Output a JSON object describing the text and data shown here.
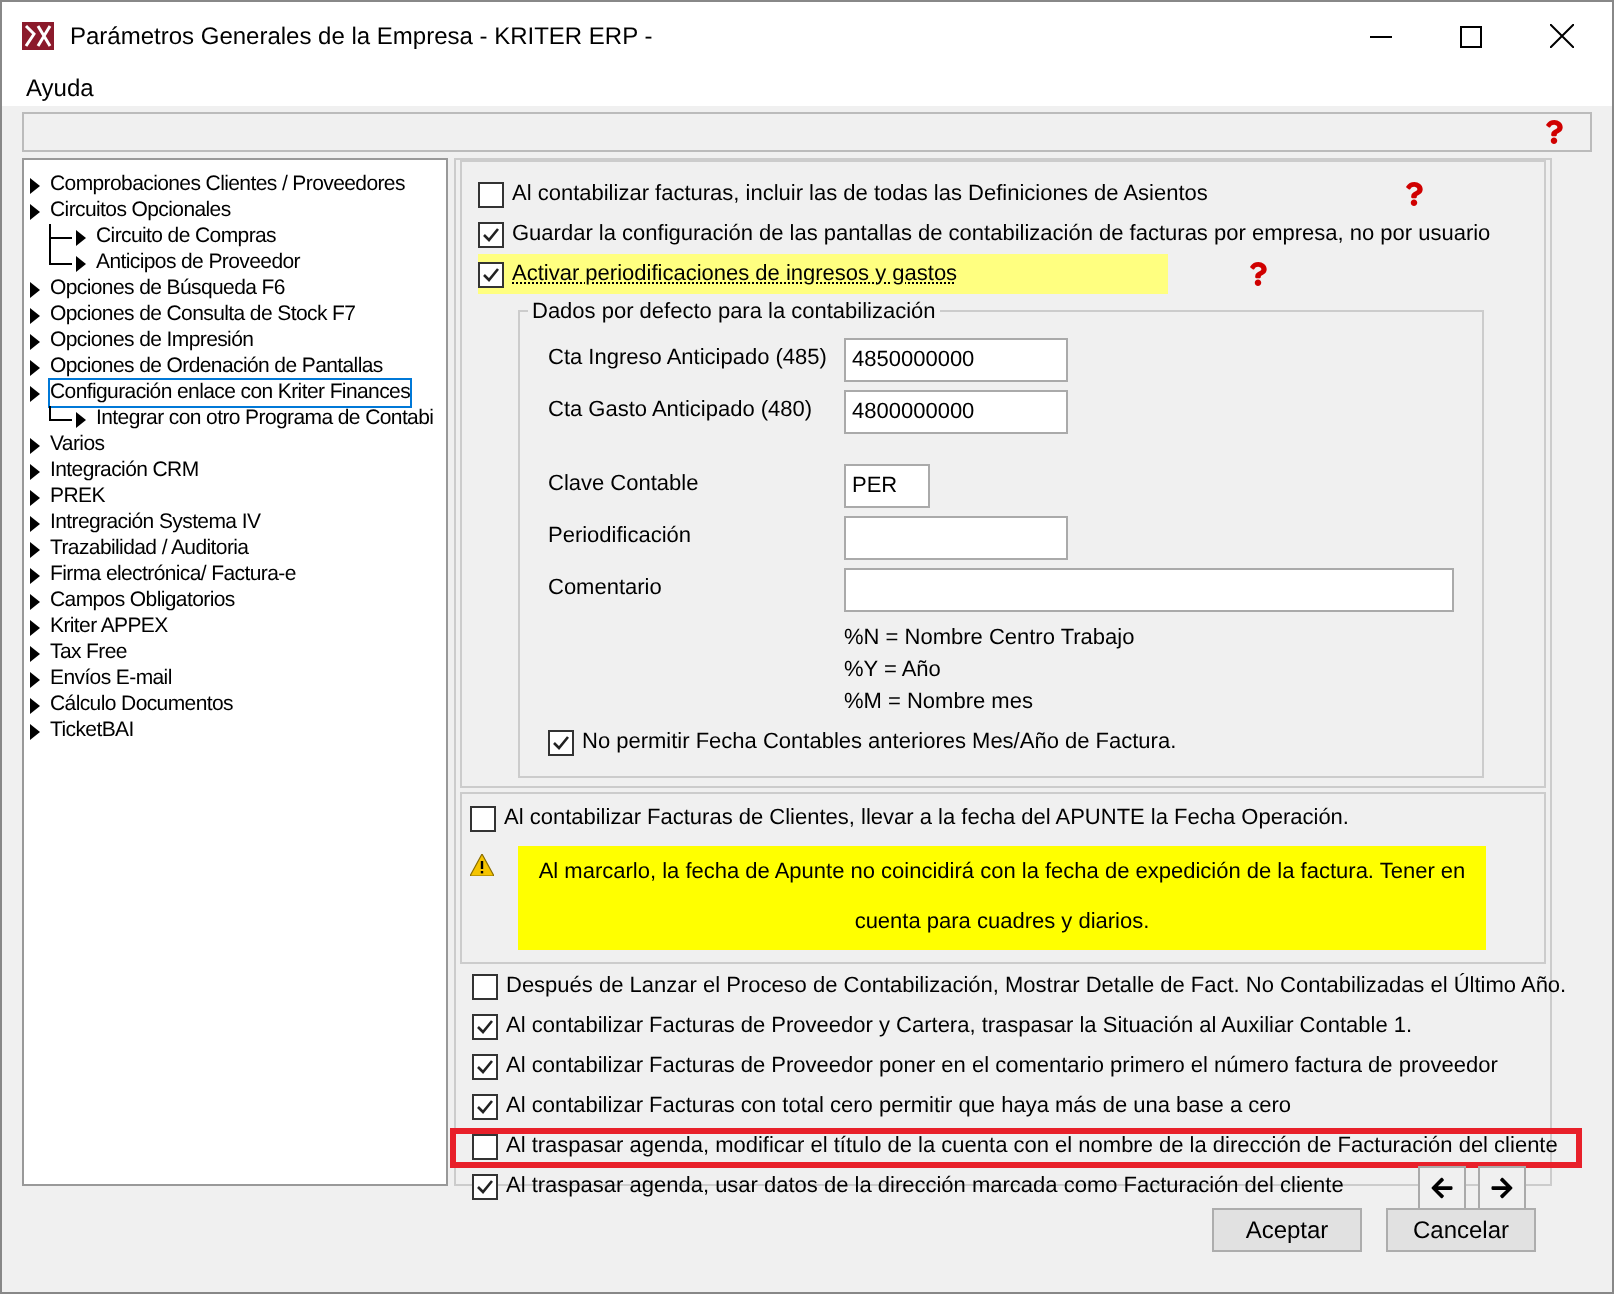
{
  "window": {
    "title": "Parámetros Generales de la Empresa - KRITER ERP -"
  },
  "menu": [
    "Ayuda"
  ],
  "tree": [
    {
      "label": "Comprobaciones Clientes / Proveedores",
      "selected": false
    },
    {
      "label": "Circuitos Opcionales",
      "selected": false,
      "children": [
        {
          "label": "Circuito de Compras",
          "selected": false
        },
        {
          "label": "Anticipos de Proveedor",
          "selected": false
        }
      ]
    },
    {
      "label": "Opciones de Búsqueda F6",
      "selected": false
    },
    {
      "label": "Opciones de Consulta de Stock F7",
      "selected": false
    },
    {
      "label": "Opciones de Impresión",
      "selected": false
    },
    {
      "label": "Opciones de Ordenación de Pantallas",
      "selected": false
    },
    {
      "label": "Configuración enlace con Kriter Finances",
      "selected": true,
      "children": [
        {
          "label": "Integrar con otro Programa de Contabi",
          "selected": false
        }
      ]
    },
    {
      "label": "Varios",
      "selected": false
    },
    {
      "label": "Integración CRM",
      "selected": false
    },
    {
      "label": "PREK",
      "selected": false
    },
    {
      "label": "Intregración Systema IV",
      "selected": false
    },
    {
      "label": "Trazabilidad / Auditoria",
      "selected": false
    },
    {
      "label": "Firma electrónica/ Factura-e",
      "selected": false
    },
    {
      "label": "Campos Obligatorios",
      "selected": false
    },
    {
      "label": "Kriter APPEX",
      "selected": false
    },
    {
      "label": "Tax Free",
      "selected": false
    },
    {
      "label": "Envíos E-mail",
      "selected": false
    },
    {
      "label": "Cálculo Documentos",
      "selected": false
    },
    {
      "label": "TicketBAI",
      "selected": false
    }
  ],
  "options_top": [
    {
      "label": "Al contabilizar facturas, incluir las de todas las Definiciones de Asientos",
      "checked": false,
      "highlighted": false,
      "help": true
    },
    {
      "label": "Guardar la configuración de las pantallas de contabilización de facturas por empresa, no por usuario",
      "checked": true,
      "highlighted": false,
      "help": false
    },
    {
      "label": "Activar periodificaciones de ingresos y gastos",
      "checked": true,
      "highlighted": true,
      "help": true
    }
  ],
  "defaults_group": {
    "title": "Dados por defecto para la contabilización",
    "fields": [
      {
        "label": "Cta Ingreso Anticipado (485)",
        "value": "4850000000"
      },
      {
        "label": "Cta Gasto Anticipado (480)",
        "value": "4800000000"
      },
      {
        "label": "Clave Contable",
        "value": "PER"
      },
      {
        "label": "Periodificación"
      },
      {
        "label": "Comentario"
      }
    ],
    "hints": [
      "%N = Nombre Centro Trabajo",
      "%Y = Año",
      "%M = Nombre mes"
    ],
    "checkbox": {
      "label": "No permitir Fecha Contables anteriores Mes/Año de Factura.",
      "checked": true
    }
  },
  "client_date": {
    "label": "Al contabilizar Facturas de Clientes, llevar a la fecha del APUNTE la Fecha Operación.",
    "checked": false,
    "warning": "Al marcarlo, la fecha de Apunte no coincidirá con la fecha de expedición de la factura. Tener en cuenta para cuadres y diarios."
  },
  "options_bottom": [
    {
      "label": "Después de Lanzar el Proceso de Contabilización, Mostrar Detalle de Fact. No Contabilizadas el Último Año.",
      "checked": false,
      "marked": false
    },
    {
      "label": "Al contabilizar Facturas de Proveedor y Cartera, traspasar la Situación al Auxiliar Contable 1.",
      "checked": true,
      "marked": false
    },
    {
      "label": "Al contabilizar Facturas de Proveedor poner en el comentario primero el número factura de proveedor",
      "checked": true,
      "marked": false
    },
    {
      "label": "Al contabilizar Facturas con total cero permitir que haya más de una base a cero",
      "checked": true,
      "marked": false
    },
    {
      "label": "Al traspasar agenda, modificar el título de la cuenta con el nombre de la dirección de Facturación del cliente",
      "checked": false,
      "marked": true
    },
    {
      "label": "Al traspasar agenda, usar datos de la dirección marcada como Facturación del cliente",
      "checked": true,
      "marked": false
    }
  ],
  "buttons": [
    "Aceptar",
    "Cancelar"
  ]
}
